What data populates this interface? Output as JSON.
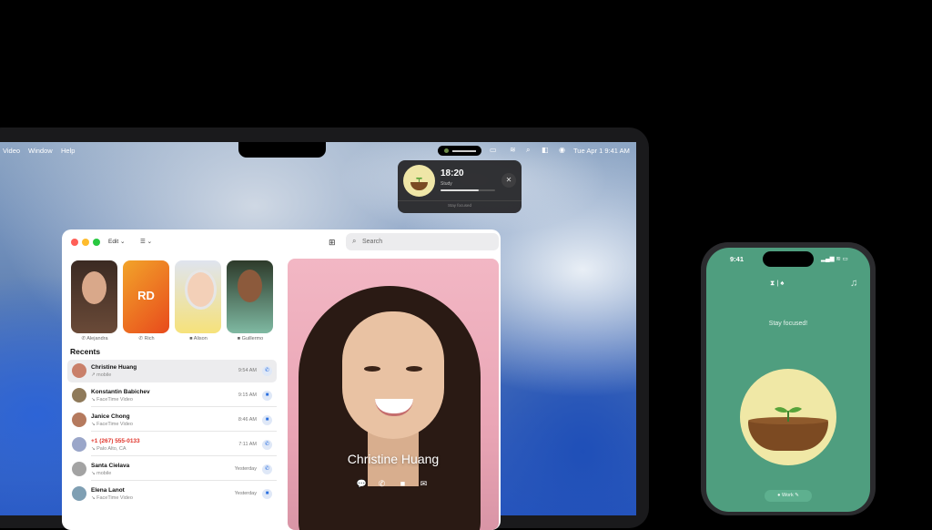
{
  "menubar": {
    "left_items": [
      "Video",
      "Window",
      "Help"
    ],
    "clock": "Tue Apr 1  9:41 AM"
  },
  "forest_popover": {
    "time": "18:20",
    "label": "Study",
    "progress": 0.7,
    "footer": "Stay focused",
    "close_glyph": "✕"
  },
  "facetime": {
    "toolbar": {
      "edit_label": "Edit ⌄",
      "filter_label": "☰ ⌄"
    },
    "search_placeholder": "Search",
    "favorites": [
      {
        "name": "Alejandra",
        "type_icon": "✆"
      },
      {
        "name": "Rich",
        "type_icon": "✆",
        "initials": "RD"
      },
      {
        "name": "Alison",
        "type_icon": "■"
      },
      {
        "name": "Guillermo",
        "type_icon": "■"
      }
    ],
    "recents_title": "Recents",
    "recents": [
      {
        "name": "Christine Huang",
        "sub": "↗ mobile",
        "time": "9:54 AM",
        "action": "✆",
        "selected": true,
        "color": "#c9806a"
      },
      {
        "name": "Konstantin Babichev",
        "sub": "↘ FaceTime Video",
        "time": "9:15 AM",
        "action": "■",
        "color": "#8f7a5a"
      },
      {
        "name": "Janice Chong",
        "sub": "↘ FaceTime Video",
        "time": "8:46 AM",
        "action": "■",
        "color": "#b57a5e"
      },
      {
        "name": "+1 (267) 555-0133",
        "sub": "↘ Palo Alto, CA",
        "time": "7:11 AM",
        "action": "✆",
        "missed": true,
        "color": "#9aa6c9"
      },
      {
        "name": "Santa Cielava",
        "sub": "↘ mobile",
        "time": "Yesterday",
        "action": "✆",
        "color": "#a3a3a3"
      },
      {
        "name": "Elena Lanot",
        "sub": "↘ FaceTime Video",
        "time": "Yesterday",
        "action": "■",
        "color": "#7f9fb3"
      }
    ],
    "video": {
      "caller_name": "Christine Huang",
      "buttons": [
        "💬",
        "✆",
        "■",
        "✉"
      ]
    }
  },
  "phone": {
    "time": "9:41",
    "status": "▂▄▆ ≋ ▭",
    "top_icons": "⧗ | ♠",
    "headphones_icon": "♫",
    "message": "Stay focused!",
    "tag": "● Work ✎"
  }
}
